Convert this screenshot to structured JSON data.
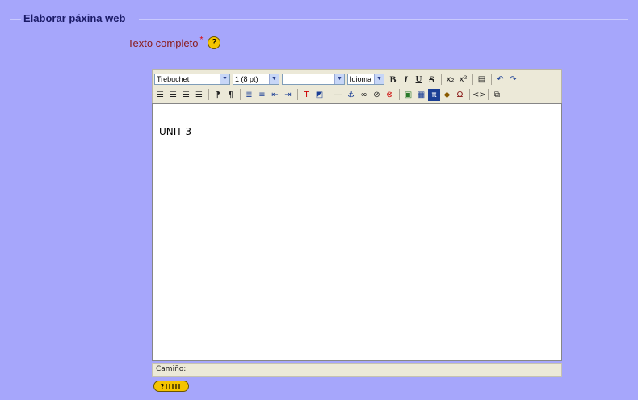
{
  "fieldset": {
    "legend": "Elaborar páxina web"
  },
  "field": {
    "label": "Texto completo",
    "required_mark": "*",
    "help_symbol": "?"
  },
  "toolbar": {
    "font_family": "Trebuchet",
    "font_size": "1 (8 pt)",
    "format": "",
    "language": "Idioma",
    "bold": "B",
    "italic": "I",
    "underline": "U",
    "strike": "S"
  },
  "editor": {
    "content": "UNIT 3"
  },
  "statusbar": {
    "path_label": "Camiño:"
  },
  "keyboard_help": {
    "symbol": "?"
  }
}
